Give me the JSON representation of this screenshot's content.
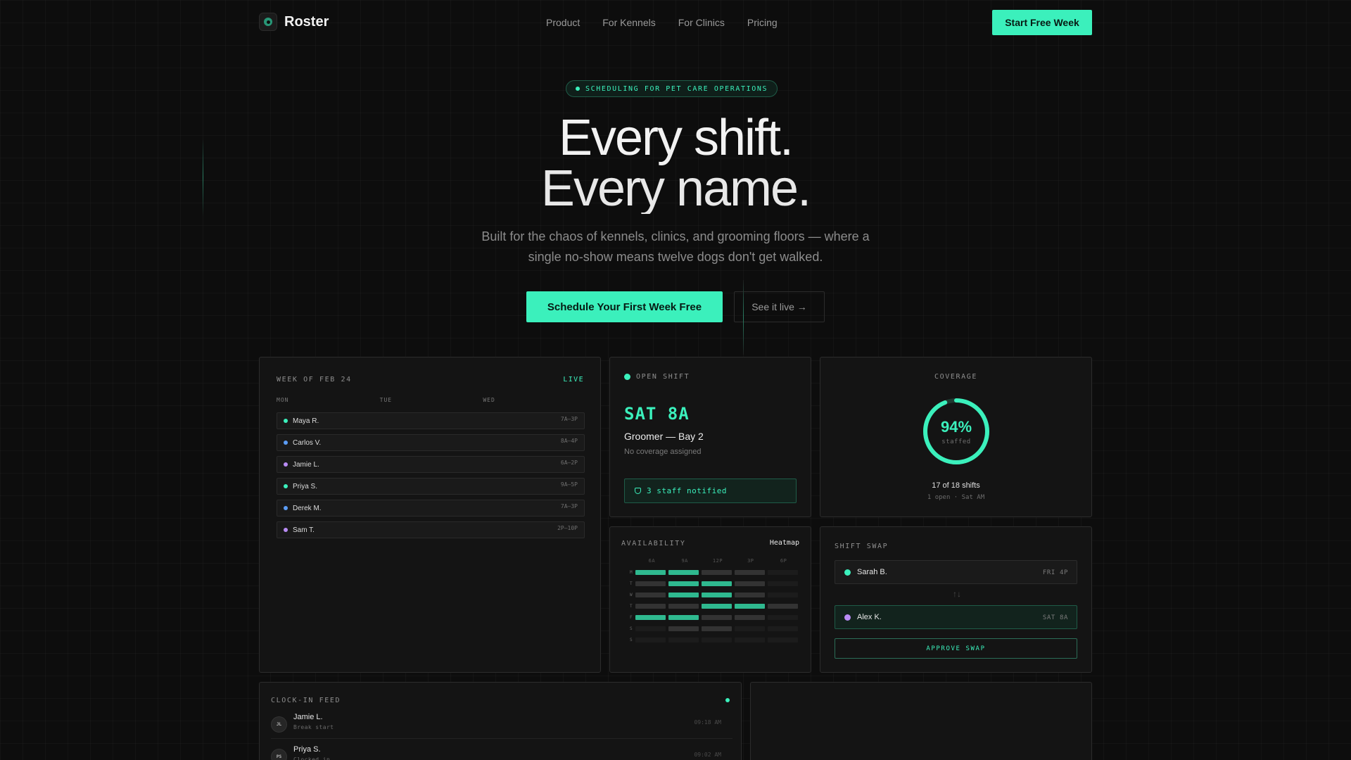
{
  "nav": {
    "brand": "Roster",
    "links": [
      "Product",
      "For Kennels",
      "For Clinics",
      "Pricing"
    ],
    "cta": "Start Free Week"
  },
  "hero": {
    "badge": "SCHEDULING FOR PET CARE OPERATIONS",
    "title_line1": "Every shift.",
    "title_line2": "Every name.",
    "subtitle_line1": "Built for the chaos of kennels, clinics, and grooming floors — where a",
    "subtitle_line2": "single no-show means twelve dogs don't get walked.",
    "primary_cta": "Schedule Your First Week Free",
    "secondary_cta": "See it live →"
  },
  "week_card": {
    "label": "WEEK OF FEB 24",
    "status": "LIVE",
    "days": [
      "MON",
      "TUE",
      "WED"
    ],
    "rows": [
      {
        "name": "Maya R.",
        "time": "7A–3P",
        "color": "#3bf0bc"
      },
      {
        "name": "Carlos V.",
        "time": "8A–4P",
        "color": "#5b9cf5"
      },
      {
        "name": "Jamie L.",
        "time": "6A–2P",
        "color": "#b98cf5"
      },
      {
        "name": "Priya S.",
        "time": "9A–5P",
        "color": "#3bf0bc"
      },
      {
        "name": "Derek M.",
        "time": "7A–3P",
        "color": "#5b9cf5"
      },
      {
        "name": "Sam T.",
        "time": "2P–10P",
        "color": "#b98cf5"
      }
    ]
  },
  "open_shift": {
    "label": "OPEN SHIFT",
    "slot": "SAT 8A",
    "role": "Groomer — Bay 2",
    "note": "No coverage assigned",
    "notified": "3 staff notified"
  },
  "coverage": {
    "label": "COVERAGE",
    "percent": 94,
    "percent_text": "94%",
    "sub": "staffed",
    "summary": "17 of 18 shifts",
    "detail": "1 open · Sat AM"
  },
  "availability": {
    "label": "AVAILABILITY",
    "tag": "Heatmap",
    "columns": [
      "6A",
      "9A",
      "12P",
      "3P",
      "6P"
    ],
    "rows": [
      {
        "day": "M",
        "levels": [
          3,
          3,
          1,
          1,
          0
        ]
      },
      {
        "day": "T",
        "levels": [
          1,
          3,
          3,
          1,
          0
        ]
      },
      {
        "day": "W",
        "levels": [
          1,
          3,
          3,
          1,
          0
        ]
      },
      {
        "day": "T",
        "levels": [
          1,
          1,
          3,
          3,
          1
        ]
      },
      {
        "day": "F",
        "levels": [
          3,
          3,
          1,
          1,
          0
        ]
      },
      {
        "day": "S",
        "levels": [
          0,
          1,
          1,
          0,
          0
        ]
      },
      {
        "day": "S",
        "levels": [
          0,
          0,
          0,
          0,
          0
        ]
      }
    ]
  },
  "shift_swap": {
    "label": "SHIFT SWAP",
    "from": {
      "name": "Sarah B.",
      "when": "FRI 4P",
      "color": "#3bf0bc"
    },
    "to": {
      "name": "Alex K.",
      "when": "SAT 8A",
      "color": "#b98cf5"
    },
    "arrows": "↑↓",
    "action": "APPROVE SWAP"
  },
  "feed": {
    "label": "CLOCK-IN FEED",
    "items": [
      {
        "initials": "JL",
        "name": "Jamie L.",
        "event": "Break start",
        "time": "09:18 AM"
      },
      {
        "initials": "PS",
        "name": "Priya S.",
        "event": "Clocked in",
        "time": "09:02 AM"
      }
    ]
  },
  "colors": {
    "accent": "#3bf0bc",
    "background": "#0d0d0d",
    "card": "#141414"
  }
}
